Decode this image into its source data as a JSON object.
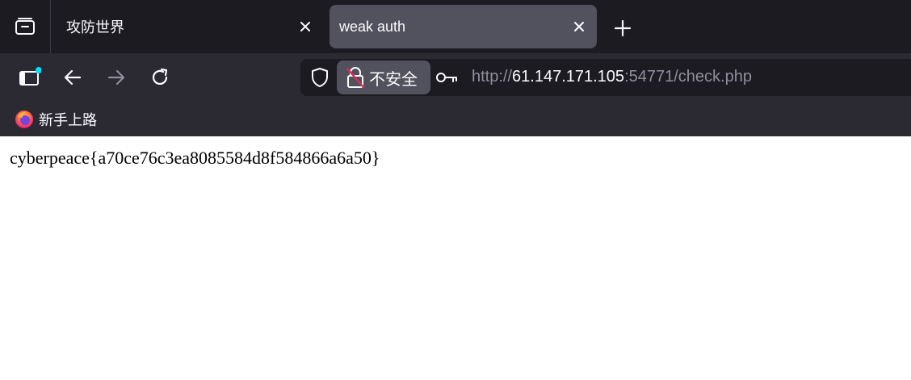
{
  "window": {
    "tabs": [
      {
        "title": "攻防世界",
        "active": false
      },
      {
        "title": "weak auth",
        "active": true
      }
    ]
  },
  "toolbar": {
    "icons": {
      "tab_list": "tab-list-icon",
      "sidebar": "sidebar-icon",
      "back": "back-arrow-icon",
      "forward": "forward-arrow-icon",
      "reload": "reload-icon",
      "new_tab": "plus-icon",
      "close": "close-icon"
    }
  },
  "urlbar": {
    "security_label": "不安全",
    "url_scheme": "http://",
    "url_host": "61.147.171.105",
    "url_rest": ":54771/check.php"
  },
  "bookmarks": {
    "items": [
      {
        "label": "新手上路",
        "icon": "firefox-icon"
      }
    ]
  },
  "page": {
    "body_text": "cyberpeace{a70ce76c3ea8085584d8f584866a6a50}"
  },
  "colors": {
    "tabbar_bg": "#1c1b22",
    "toolbar_bg": "#2b2a33",
    "active_tab_bg": "#52515e",
    "accent_dot": "#0df"
  }
}
